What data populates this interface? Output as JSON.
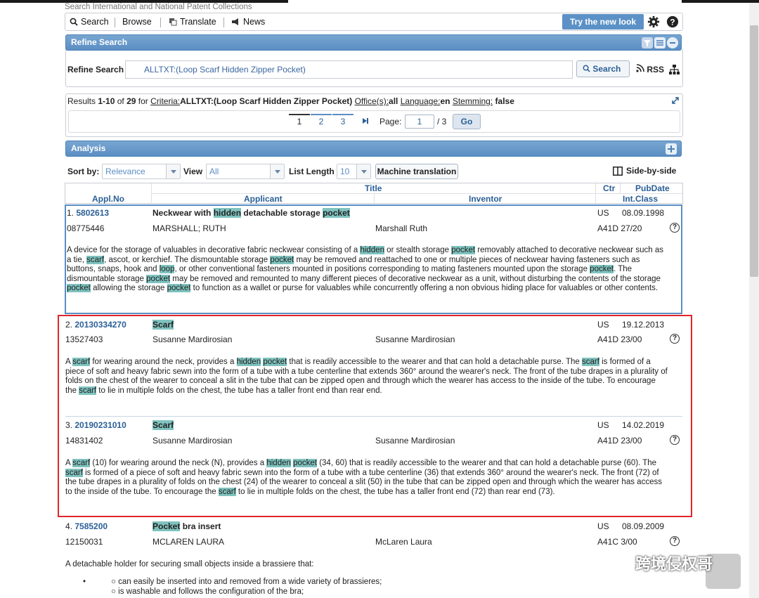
{
  "header": {
    "tagline": "Search International and National Patent Collections"
  },
  "nav": {
    "search": "Search",
    "browse": "Browse",
    "translate": "Translate",
    "news": "News",
    "try_new": "Try the new look"
  },
  "refine": {
    "panel_title": "Refine Search",
    "label": "Refine Search",
    "query": "ALLTXT:(Loop Scarf Hidden Zipper Pocket)",
    "search_btn": "Search",
    "rss": "RSS"
  },
  "results": {
    "prefix": "Results ",
    "range": "1-10",
    "of": " of ",
    "total": "29",
    "for": " for ",
    "criteria_label": "Criteria:",
    "criteria_value": "ALLTXT:(Loop Scarf Hidden Zipper Pocket)",
    "office_label": "Office(s):",
    "office_value": "all",
    "language_label": "Language:",
    "language_value": "en",
    "stemming_label": "Stemming:",
    "stemming_value": "false"
  },
  "pager": {
    "p1": "1",
    "p2": "2",
    "p3": "3",
    "page_label": "Page:",
    "current": "1",
    "of_total": "/ 3",
    "go": "Go"
  },
  "analysis": {
    "title": "Analysis"
  },
  "controls": {
    "sort_label": "Sort by:",
    "sort_value": "Relevance",
    "view_label": "View",
    "view_value": "All",
    "list_label": "List Length",
    "list_value": "10",
    "machine_translation": "Machine translation",
    "side_by_side": "Side-by-side"
  },
  "columns": {
    "title": "Title",
    "ctr": "Ctr",
    "pubdate": "PubDate",
    "applno": "Appl.No",
    "applicant": "Applicant",
    "inventor": "Inventor",
    "intclass": "Int.Class"
  },
  "rows": [
    {
      "num": "1.",
      "id": "5802613",
      "appl": "08775446",
      "applicant": "MARSHALL; RUTH",
      "inventor": "Marshall Ruth",
      "ctr": "US",
      "date": "08.09.1998",
      "cls": "A41D 27/20"
    },
    {
      "num": "2.",
      "id": "20130334270",
      "appl": "13527403",
      "applicant": "Susanne Mardirosian",
      "inventor": "Susanne Mardirosian",
      "ctr": "US",
      "date": "19.12.2013",
      "cls": "A41D 23/00"
    },
    {
      "num": "3.",
      "id": "20190231010",
      "appl": "14831402",
      "applicant": "Susanne Mardirosian",
      "inventor": "Susanne Mardirosian",
      "ctr": "US",
      "date": "14.02.2019",
      "cls": "A41D 23/00"
    },
    {
      "num": "4.",
      "id": "7585200",
      "appl": "12150031",
      "applicant": "MCLAREN LAURA",
      "inventor": "McLaren Laura",
      "ctr": "US",
      "date": "08.09.2009",
      "cls": "A41C 3/00"
    }
  ],
  "titles": {
    "r1": [
      "Neckwear with ",
      "hidden",
      " detachable storage ",
      "pocket"
    ],
    "r2": "Scarf",
    "r3": "Scarf",
    "r4": [
      "Pocket",
      " bra insert"
    ]
  },
  "abstracts": {
    "r1": [
      [
        "A device for the storage of valuables in decorative fabric neckwear consisting of a ",
        "hidden",
        " or stealth storage ",
        "pocket",
        " removably attached to decorative neckwear such as"
      ],
      [
        "a tie, ",
        "scarf",
        ", ascot, or kerchief. The dismountable storage ",
        "pocket",
        " may be removed and reattached to one or multiple pieces of neckwear having fasteners such as"
      ],
      [
        "buttons, snaps, hook and ",
        "loop",
        ", or other conventional fasteners mounted in positions corresponding to mating fasteners mounted upon the storage ",
        "pocket",
        ". The"
      ],
      [
        "dismountable storage ",
        "pocket",
        " may be removed and remounted to many different pieces of decorative neckwear as a unit, without disturbing the contents of the storage"
      ],
      [
        "",
        "pocket",
        " allowing the storage ",
        "pocket",
        " to function as a wallet or purse for valuables while concurrently offering a non obvious hiding place for valuables or other contents."
      ]
    ],
    "r2": [
      [
        "A ",
        "scarf",
        " for wearing around the neck, provides a ",
        "hidden",
        " ",
        "pocket",
        " that is readily accessible to the wearer and that can hold a detachable purse. The ",
        "scarf",
        " is formed of a"
      ],
      [
        "piece of soft and heavy fabric sewn into the form of a tube with a tube centerline that extends 360° around the wearer's neck. The front of the tube drapes in a plurality of"
      ],
      [
        "folds on the chest of the wearer to conceal a slit in the tube that can be zipped open and through which the wearer has access to the inside of the tube. To encourage"
      ],
      [
        "the ",
        "scarf",
        " to lie in multiple folds on the chest, the tube has a taller front end than rear end."
      ]
    ],
    "r3": [
      [
        "A ",
        "scarf",
        " (10) for wearing around the neck (N), provides a ",
        "hidden",
        " ",
        "pocket",
        " (34, 60) that is readily accessible to the wearer and that can hold a detachable purse (60). The"
      ],
      [
        "",
        "scarf",
        " is formed of a piece of soft and heavy fabric sewn into the form of a tube with a tube centerline (36) that extends 360° around the wearer's neck. The front (72) of"
      ],
      [
        "the tube drapes in a plurality of folds on the chest (24) of the wearer to conceal a slit (50) in the tube that can be zipped open and through which the wearer has access"
      ],
      [
        "to the inside of the tube. To encourage the ",
        "scarf",
        " to lie in multiple folds on the chest, the tube has a taller front end (72) than rear end (73)."
      ]
    ],
    "r4": "A detachable holder for securing small objects inside a brassiere that:",
    "r4_bullets": [
      "can easily be inserted into and removed from a wide variety of brassieres;",
      "is washable and follows the configuration of the bra;"
    ]
  },
  "watermark": {
    "text": "跨境侵权哥"
  }
}
